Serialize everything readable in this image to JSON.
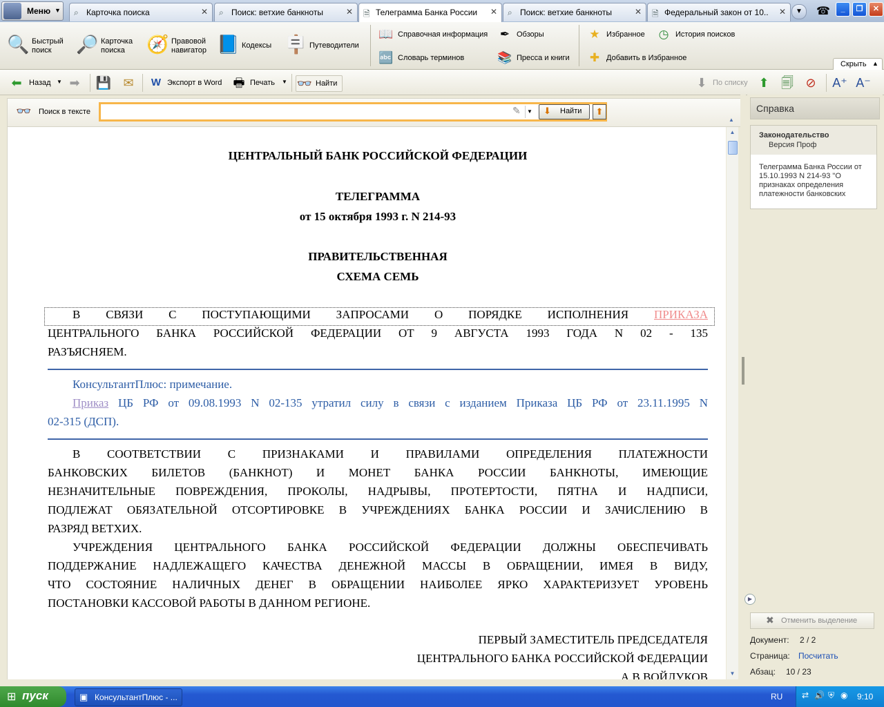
{
  "tabbar": {
    "menu_label": "Меню",
    "tabs": [
      {
        "label": "Карточка поиска",
        "icon": "magnifier-icon"
      },
      {
        "label": "Поиск: ветхие банкноты",
        "icon": "magnifier-icon"
      },
      {
        "label": "Телеграмма Банка России о...",
        "icon": "document-icon",
        "active": true
      },
      {
        "label": "Поиск: ветхие банкноты",
        "icon": "magnifier-icon"
      },
      {
        "label": "Федеральный закон от 10....",
        "icon": "document-icon"
      }
    ]
  },
  "main_toolbar": {
    "quick_search": "Быстрый\nпоиск",
    "search_card": "Карточка\nпоиска",
    "legal_navigator": "Правовой\nнавигатор",
    "codes": "Кодексы",
    "guides": "Путеводители",
    "reference_info": "Справочная информация",
    "glossary": "Словарь терминов",
    "reviews": "Обзоры",
    "press_books": "Пресса и книги",
    "favorites": "Избранное",
    "add_favorites": "Добавить в Избранное",
    "search_history": "История поисков",
    "hide": "Скрыть"
  },
  "nav_toolbar": {
    "back": "Назад",
    "export_word": "Экспорт в Word",
    "print": "Печать",
    "find": "Найти",
    "by_list": "По списку"
  },
  "searchbar": {
    "label": "Поиск в тексте",
    "input_value": "",
    "find_button": "Найти"
  },
  "document": {
    "org": "ЦЕНТРАЛЬНЫЙ БАНК РОССИЙСКОЙ ФЕДЕРАЦИИ",
    "doc_type": "ТЕЛЕГРАММА",
    "doc_date": "от 15 октября 1993 г. N 214-93",
    "route1": "ПРАВИТЕЛЬСТВЕННАЯ",
    "route2": "СХЕМА СЕМЬ",
    "p1_line1_text": "В СВЯЗИ С ПОСТУПАЮЩИМИ ЗАПРОСАМИ О ПОРЯДКЕ ИСПОЛНЕНИЯ",
    "p1_line1_link": "ПРИКАЗА",
    "p1_line2": "ЦЕНТРАЛЬНОГО БАНКА РОССИЙСКОЙ ФЕДЕРАЦИИ ОТ 9 АВГУСТА 1993 ГОДА N 02 - 135",
    "p1_line3": "РАЗЪЯСНЯЕМ.",
    "note_title": "КонсультантПлюс: примечание.",
    "note_link": "Приказ",
    "note_line1_rest": "ЦБ РФ от 09.08.1993 N 02-135 утратил силу в связи с изданием Приказа ЦБ РФ от 23.11.1995 N",
    "note_line2": "02-315 (ДСП).",
    "p2_lines": [
      "В СООТВЕТСТВИИ С ПРИЗНАКАМИ И ПРАВИЛАМИ ОПРЕДЕЛЕНИЯ ПЛАТЕЖНОСТИ",
      "БАНКОВСКИХ БИЛЕТОВ (БАНКНОТ) И МОНЕТ БАНКА РОССИИ БАНКНОТЫ, ИМЕЮЩИЕ",
      "НЕЗНАЧИТЕЛЬНЫЕ ПОВРЕЖДЕНИЯ, ПРОКОЛЫ, НАДРЫВЫ, ПРОТЕРТОСТИ, ПЯТНА И НАДПИСИ,",
      "ПОДЛЕЖАТ ОБЯЗАТЕЛЬНОЙ ОТСОРТИРОВКЕ В УЧРЕЖДЕНИЯХ БАНКА РОССИИ И ЗАЧИСЛЕНИЮ В",
      "РАЗРЯД ВЕТХИХ."
    ],
    "p3_lines": [
      "УЧРЕЖДЕНИЯ ЦЕНТРАЛЬНОГО БАНКА РОССИЙСКОЙ ФЕДЕРАЦИИ ДОЛЖНЫ ОБЕСПЕЧИВАТЬ",
      "ПОДДЕРЖАНИЕ НАДЛЕЖАЩЕГО КАЧЕСТВА ДЕНЕЖНОЙ МАССЫ В ОБРАЩЕНИИ, ИМЕЯ В ВИДУ,",
      "ЧТО СОСТОЯНИЕ НАЛИЧНЫХ ДЕНЕГ В ОБРАЩЕНИИ НАИБОЛЕЕ ЯРКО ХАРАКТЕРИЗУЕТ УРОВЕНЬ",
      "ПОСТАНОВКИ КАССОВОЙ РАБОТЫ В ДАННОМ РЕГИОНЕ."
    ],
    "sign1": "ПЕРВЫЙ ЗАМЕСТИТЕЛЬ ПРЕДСЕДАТЕЛЯ",
    "sign2": "ЦЕНТРАЛЬНОГО БАНКА РОССИЙСКОЙ ФЕДЕРАЦИИ",
    "sign3": "А.В.ВОЙЛУКОВ"
  },
  "right_panel": {
    "title": "Справка",
    "card_title": "Законодательство",
    "card_subtitle": "Версия Проф",
    "card_body": "Телеграмма Банка России от 15.10.1993 N 214-93 \"О признаках определения платежности банковских",
    "cancel_selection": "Отменить выделение",
    "doc_label": "Документ:",
    "doc_value": "2 / 2",
    "page_label": "Страница:",
    "page_value": "Посчитать",
    "para_label": "Абзац:",
    "para_value": "10 / 23"
  },
  "taskbar": {
    "start": "пуск",
    "task_label": "КонсультантПлюс - ...",
    "lang": "RU",
    "clock": "9:10"
  },
  "colors": {
    "accent_orange": "#f7b64a",
    "note_blue": "#2d5da6",
    "link_red": "#f08c8c",
    "taskbar_blue": "#2458d1"
  }
}
